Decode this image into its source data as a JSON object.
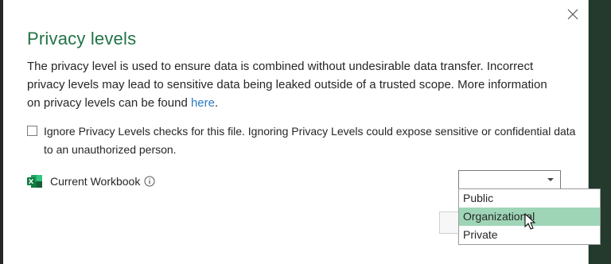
{
  "dialog": {
    "title": "Privacy levels",
    "description_text": "The privacy level is used to ensure data is combined without undesirable data transfer. Incorrect privacy levels may lead to sensitive data being leaked outside of a trusted scope. More information on privacy levels can be found ",
    "description_link": "here",
    "description_end": ".",
    "ignore_checkbox": {
      "label": "Ignore Privacy Levels checks for this file. Ignoring Privacy Levels could expose sensitive or confidential data to an unauthorized person.",
      "checked": false
    },
    "source": {
      "icon": "excel-icon",
      "label": "Current Workbook",
      "info_icon": "info-icon"
    },
    "privacy_select": {
      "value": "",
      "options": [
        "Public",
        "Organizational",
        "Private"
      ],
      "hovered": "Organizational"
    },
    "close_icon": "close-icon"
  },
  "colors": {
    "title": "#217346",
    "link": "#2b7bc0",
    "hover": "#9fd5b7"
  }
}
